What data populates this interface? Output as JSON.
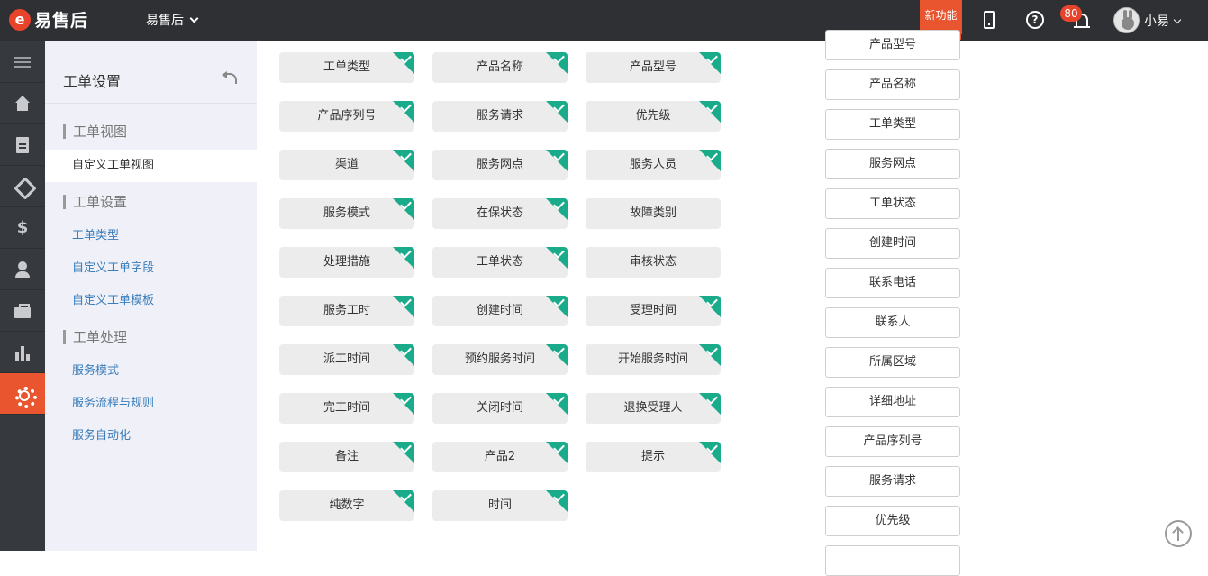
{
  "topbar": {
    "logo_mark": "e",
    "logo_text": "易售后",
    "app_name": "易售后",
    "new_feature_label": "新功能",
    "notification_count": "80",
    "user_name": "小易"
  },
  "rail": [
    {
      "name": "menu-icon"
    },
    {
      "name": "home-icon"
    },
    {
      "name": "document-icon"
    },
    {
      "name": "tag-icon"
    },
    {
      "name": "dollar-icon"
    },
    {
      "name": "user-icon"
    },
    {
      "name": "briefcase-icon"
    },
    {
      "name": "chart-icon"
    },
    {
      "name": "gear-icon",
      "active": true
    }
  ],
  "sidebar": {
    "title": "工单设置",
    "groups": [
      {
        "label": "工单视图",
        "links": [
          "自定义工单视图"
        ]
      },
      {
        "label": "工单设置",
        "links": [
          "工单类型",
          "自定义工单字段",
          "自定义工单模板"
        ]
      },
      {
        "label": "工单处理",
        "links": [
          "服务模式",
          "服务流程与规则",
          "服务自动化"
        ]
      }
    ],
    "active_link": "自定义工单视图"
  },
  "fields": [
    {
      "label": "工单类型",
      "checked": true
    },
    {
      "label": "产品名称",
      "checked": true
    },
    {
      "label": "产品型号",
      "checked": true
    },
    {
      "label": "产品序列号",
      "checked": true
    },
    {
      "label": "服务请求",
      "checked": true
    },
    {
      "label": "优先级",
      "checked": true
    },
    {
      "label": "渠道",
      "checked": true
    },
    {
      "label": "服务网点",
      "checked": true
    },
    {
      "label": "服务人员",
      "checked": true
    },
    {
      "label": "服务模式",
      "checked": true
    },
    {
      "label": "在保状态",
      "checked": true
    },
    {
      "label": "故障类别",
      "checked": false
    },
    {
      "label": "处理措施",
      "checked": true
    },
    {
      "label": "工单状态",
      "checked": true
    },
    {
      "label": "审核状态",
      "checked": false
    },
    {
      "label": "服务工时",
      "checked": true
    },
    {
      "label": "创建时间",
      "checked": true
    },
    {
      "label": "受理时间",
      "checked": true
    },
    {
      "label": "派工时间",
      "checked": true
    },
    {
      "label": "预约服务时间",
      "checked": true
    },
    {
      "label": "开始服务时间",
      "checked": true
    },
    {
      "label": "完工时间",
      "checked": true
    },
    {
      "label": "关闭时间",
      "checked": true
    },
    {
      "label": "退换受理人",
      "checked": true
    },
    {
      "label": "备注",
      "checked": true
    },
    {
      "label": "产品2",
      "checked": true
    },
    {
      "label": "提示",
      "checked": true
    },
    {
      "label": "纯数字",
      "checked": true
    },
    {
      "label": "时间",
      "checked": true
    }
  ],
  "sorted_fields": [
    "产品型号",
    "产品名称",
    "工单类型",
    "服务网点",
    "工单状态",
    "创建时间",
    "联系电话",
    "联系人",
    "所属区域",
    "详细地址",
    "产品序列号",
    "服务请求",
    "优先级",
    ""
  ]
}
